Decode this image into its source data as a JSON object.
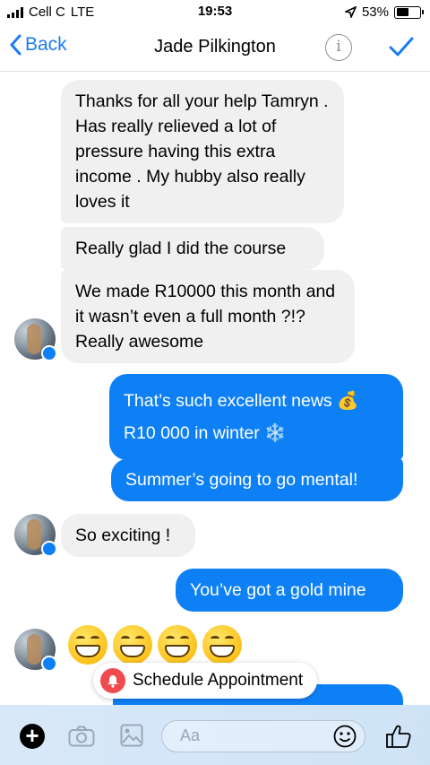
{
  "status": {
    "carrier": "Cell C",
    "network": "LTE",
    "time": "19:53",
    "battery": "53%",
    "battery_level": 0.53
  },
  "nav": {
    "back_label": "Back",
    "title": "Jade Pilkington",
    "info_glyph": "i"
  },
  "messages": [
    {
      "dir": "in",
      "text": "Thanks for all your help Tamryn . Has really relieved a lot of pressure having this extra income . My hubby also really loves it"
    },
    {
      "dir": "in",
      "text": "Really glad I did the course"
    },
    {
      "dir": "in",
      "text": "We made R10000 this month and it wasn’t even a full month ?!? Really awesome"
    },
    {
      "dir": "out",
      "text": "That’s such excellent news 💰 R10 000 in winter ❄️"
    },
    {
      "dir": "out",
      "text": "Summer’s going to go mental!"
    },
    {
      "dir": "in",
      "text": "So exciting !"
    },
    {
      "dir": "out",
      "text": "You’ve got a gold mine"
    },
    {
      "dir": "in",
      "text": "😁😁😁😁"
    }
  ],
  "schedule": {
    "label": "Schedule Appointment"
  },
  "composer": {
    "placeholder": "Aa"
  },
  "colors": {
    "accent": "#1a7cf4",
    "outgoing": "#0e80f6",
    "incoming": "#f1f0f0",
    "schedule_icon": "#f04c4f"
  },
  "icons": [
    "signal-icon",
    "location-arrow-icon",
    "battery-icon",
    "back-chevron-icon",
    "info-icon",
    "checkmark-icon",
    "avatar",
    "messenger-badge-icon",
    "bell-icon",
    "plus-icon",
    "camera-icon",
    "gallery-icon",
    "emoji-icon",
    "thumbs-up-icon"
  ]
}
